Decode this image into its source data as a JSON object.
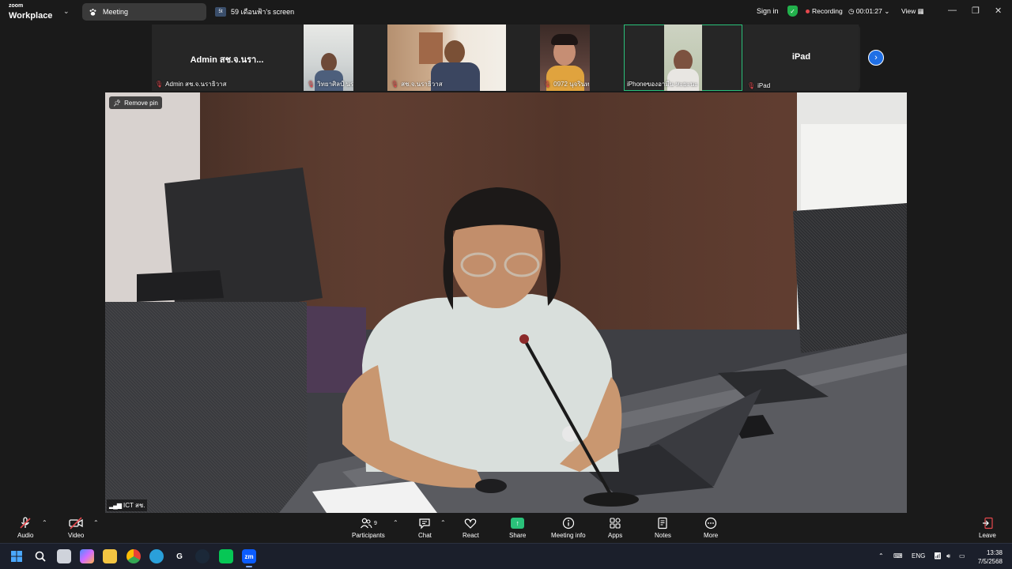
{
  "titlebar": {
    "brand_top": "zoom",
    "brand_bottom": "Workplace",
    "tabs": [
      {
        "label": "Meeting"
      },
      {
        "label": "59 เดือนฟ้า's screen",
        "badge": "5t"
      }
    ],
    "sign_in": "Sign in",
    "recording": "Recording",
    "timer": "00:01:27",
    "view": "View"
  },
  "thumbnails": [
    {
      "display_name": "Admin สช.จ.นรา...",
      "label": "Admin สช.จ.นราธิวาส",
      "muted": true
    },
    {
      "display_name": "",
      "label": "วิทยาศิลป์ นร. สช.ปัตตานี",
      "muted": true
    },
    {
      "display_name": "",
      "label": "สช.จ.นราธิวาส",
      "muted": true
    },
    {
      "display_name": "",
      "label": "0972 นุจรินทร์ มาคอปุส",
      "muted": true
    },
    {
      "display_name": "",
      "label": "iPhoneของอามีน หะยะนะ",
      "muted": false
    },
    {
      "display_name": "iPad",
      "label": "iPad",
      "muted": true
    }
  ],
  "main_video": {
    "remove_pin": "Remove pin",
    "participant_name": "ICT สช."
  },
  "toolbar": {
    "audio": "Audio",
    "video": "Video",
    "participants": "Participants",
    "participants_count": "9",
    "chat": "Chat",
    "react": "React",
    "share": "Share",
    "meeting_info": "Meeting info",
    "apps": "Apps",
    "notes": "Notes",
    "more": "More",
    "leave": "Leave"
  },
  "taskbar": {
    "language": "ENG",
    "time": "13:38",
    "date": "7/5/2568"
  },
  "colors": {
    "accent_green": "#2ac17a",
    "mute_red": "#e5484d",
    "blue": "#1f6fe5"
  }
}
